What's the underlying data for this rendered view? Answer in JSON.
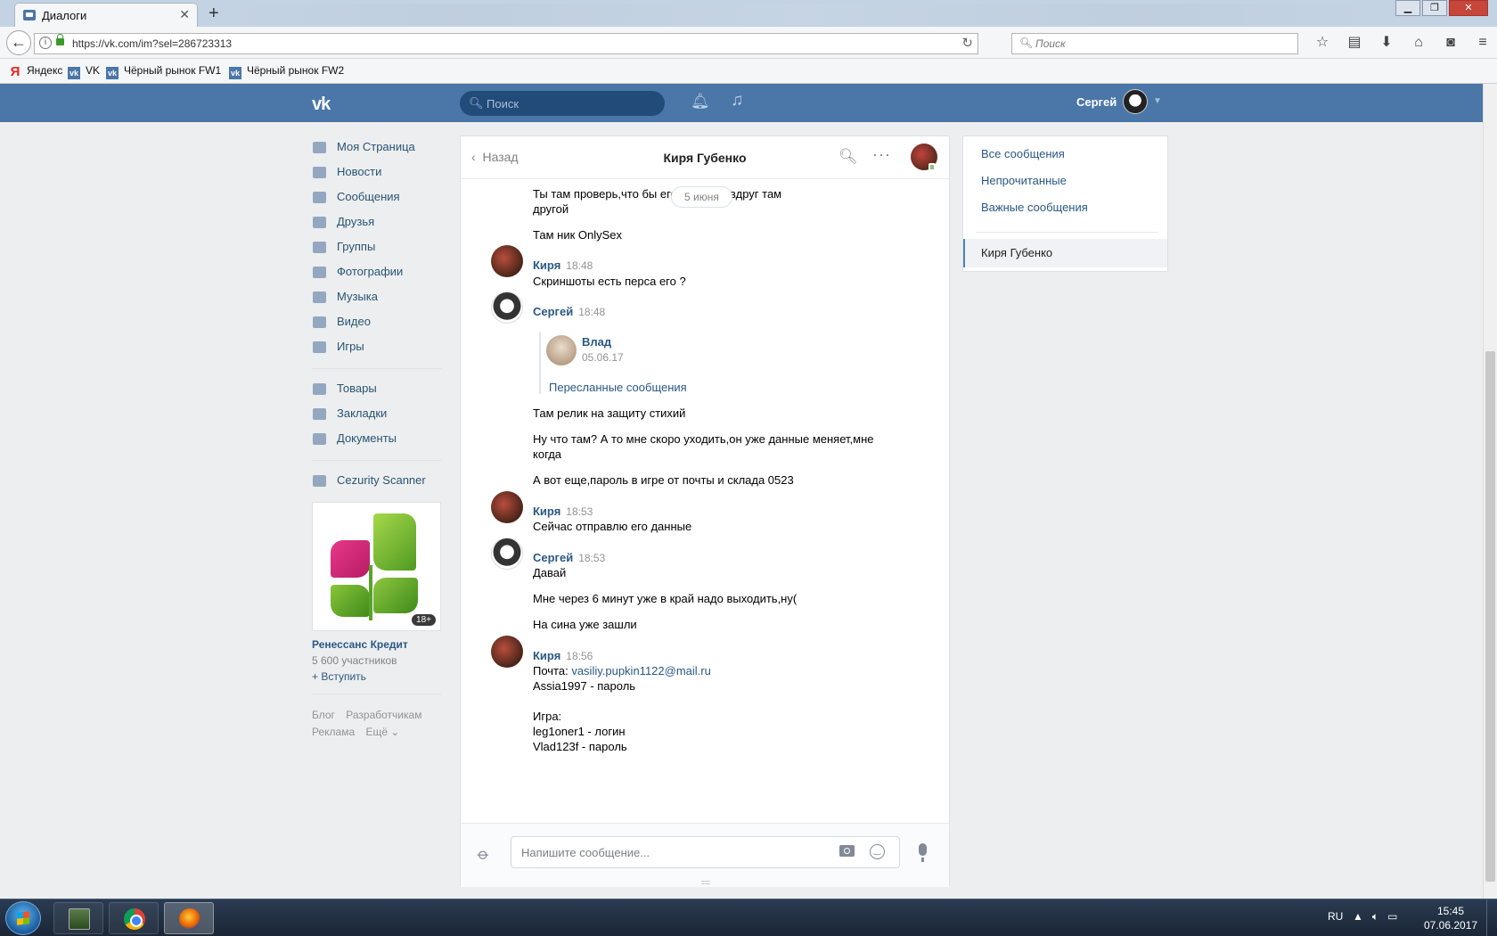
{
  "browser": {
    "tab_title": "Диалоги",
    "tab_close": "✕",
    "new_tab": "+",
    "url": "https://vk.com/im?sel=286723313",
    "search_placeholder": "Поиск",
    "bookmarks": [
      "Яндекс",
      "VK",
      "Чёрный рынок FW1",
      "Чёрный рынок FW2"
    ]
  },
  "vk_header": {
    "logo": "vk",
    "search_placeholder": "Поиск",
    "user_name": "Сергей"
  },
  "left_menu": {
    "items": [
      "Моя Страница",
      "Новости",
      "Сообщения",
      "Друзья",
      "Группы",
      "Фотографии",
      "Музыка",
      "Видео",
      "Игры"
    ],
    "items2": [
      "Товары",
      "Закладки",
      "Документы"
    ],
    "items3": [
      "Cezurity Scanner"
    ],
    "ad": {
      "badge": "18+",
      "name": "Ренессанс Кредит",
      "members": "5 600 участников",
      "join": "+ Вступить"
    },
    "footer": [
      "Блог",
      "Разработчикам",
      "Реклама",
      "Ещё ⌄"
    ]
  },
  "chat": {
    "back_label": "Назад",
    "title": "Киря Губенко",
    "date_pill": "5 июня",
    "messages": {
      "m1": "Ты там проверь,что бы его                    был,а то вдруг там",
      "m1b": "другой",
      "m2": "Там ник OnlySex",
      "a1": "Киря",
      "t1": "18:48",
      "m3": "Скриншоты есть перса его ?",
      "a2": "Сергей",
      "t2": "18:48",
      "fwd_name": "Влад",
      "fwd_date": "05.06.17",
      "fwd_link": "Пересланные сообщения",
      "m4": "Там релик на защиту стихий",
      "m5a": "Ну что там? А то мне скоро уходить,он уже данные меняет,мне",
      "m5b": "когда",
      "m6": "А вот еще,пароль в игре от почты и склада 0523",
      "a3": "Киря",
      "t3": "18:53",
      "m7": "Сейчас отправлю его данные",
      "a4": "Сергей",
      "t4": "18:53",
      "m8": "Давай",
      "m9": "Мне через 6 минут уже в край надо выходить,ну(",
      "m10": "На сина уже зашли",
      "a5": "Киря",
      "t5": "18:56",
      "m11_prefix": "Почта: ",
      "m11_link": "vasiliy.pupkin1122@mail.ru",
      "m12": "Assia1997 - пароль",
      "m13": "Игра:",
      "m14": "leg1oner1 - логин",
      "m15": "Vlad123f - пароль"
    },
    "composer_placeholder": "Напишите сообщение..."
  },
  "right_panel": {
    "items": [
      "Все сообщения",
      "Непрочитанные",
      "Важные сообщения"
    ],
    "active": "Киря Губенко"
  },
  "taskbar": {
    "lang": "RU",
    "time": "15:45",
    "date": "07.06.2017"
  },
  "colors": {
    "vk_blue": "#4a76a8",
    "link": "#2a5885",
    "page_bg": "#edeef0"
  }
}
